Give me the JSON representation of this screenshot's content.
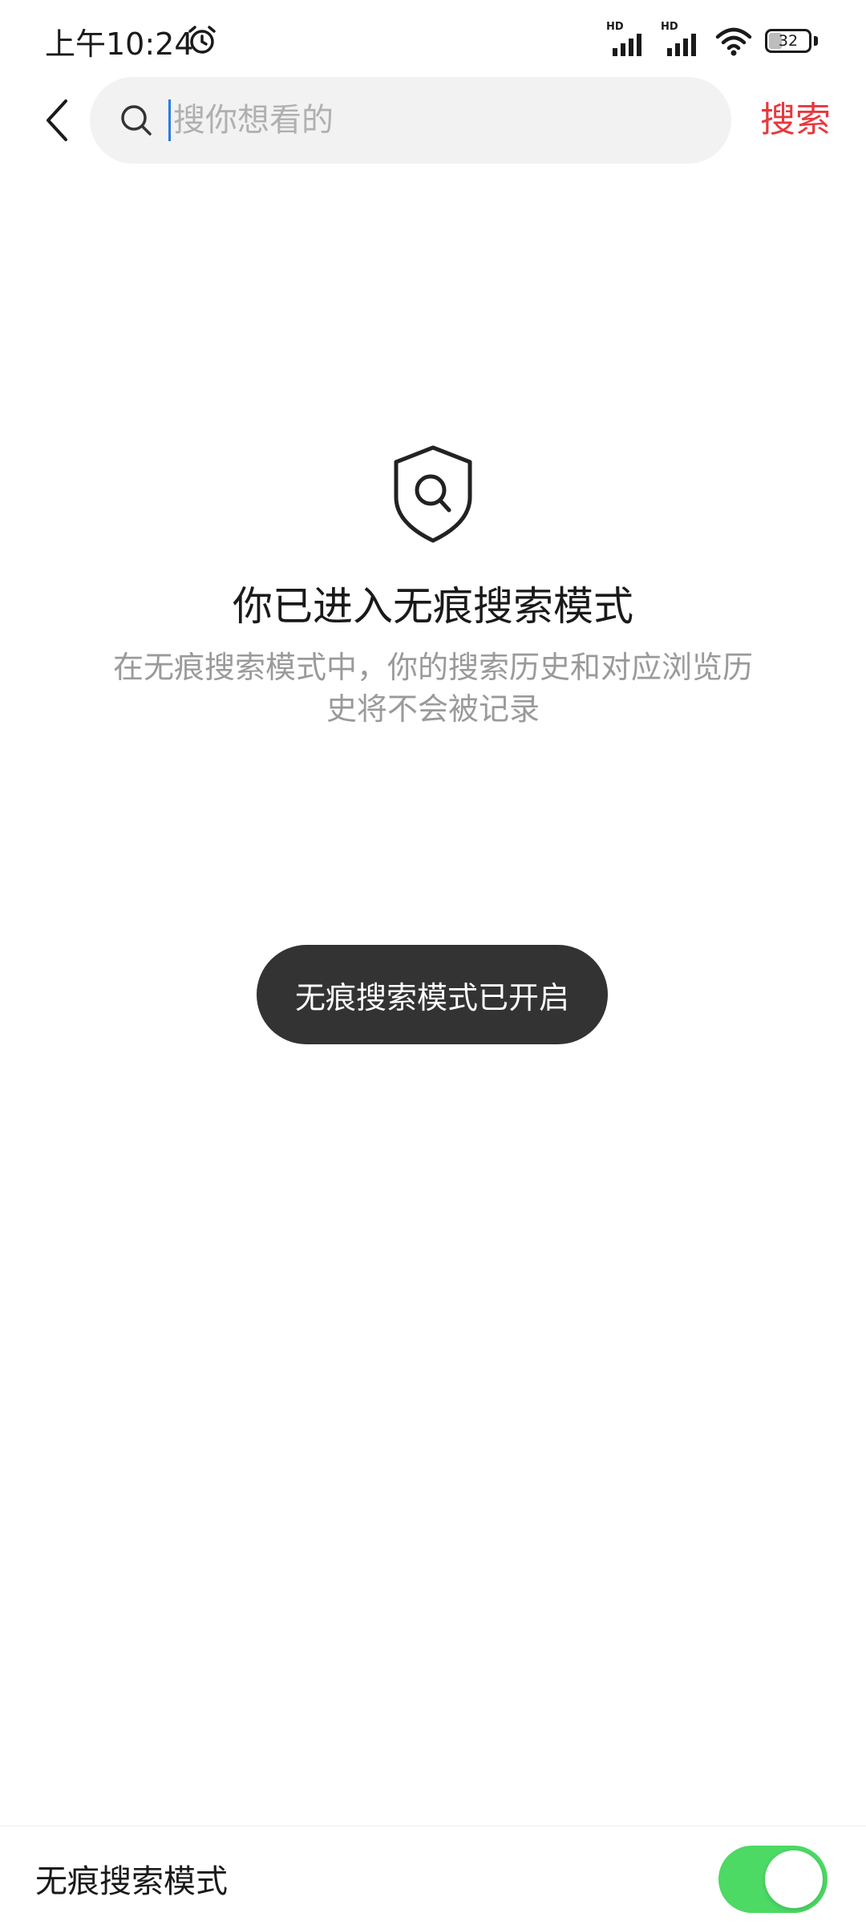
{
  "status_bar": {
    "time": "上午10:24",
    "signal_label_1": "HD",
    "signal_label_2": "HD",
    "battery_percent": "32"
  },
  "header": {
    "search_placeholder": "搜你想看的",
    "search_button_label": "搜索"
  },
  "incognito": {
    "title": "你已进入无痕搜索模式",
    "description": "在无痕搜索模式中，你的搜索历史和对应浏览历史将不会被记录"
  },
  "toast": {
    "message": "无痕搜索模式已开启"
  },
  "bottom_bar": {
    "label": "无痕搜索模式",
    "toggle_on": true
  },
  "colors": {
    "accent": "#e8383d",
    "toggle_on": "#4cd964",
    "toast_bg": "#333333"
  }
}
